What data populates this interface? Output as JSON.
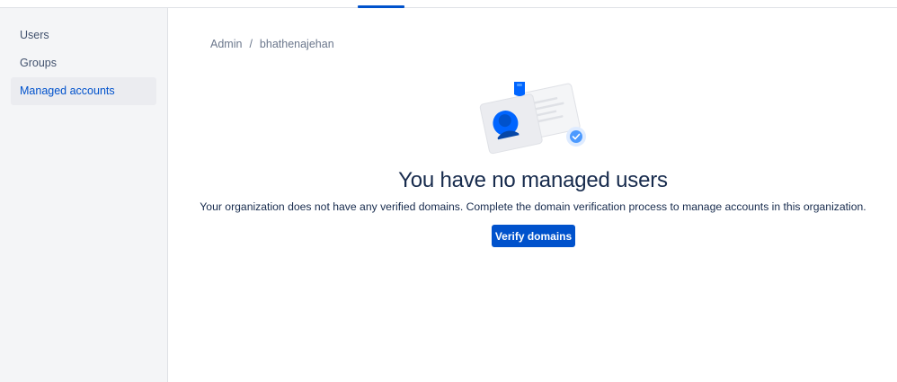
{
  "sidebar": {
    "items": [
      {
        "label": "Users",
        "active": false
      },
      {
        "label": "Groups",
        "active": false
      },
      {
        "label": "Managed accounts",
        "active": true
      }
    ]
  },
  "breadcrumb": {
    "items": [
      "Admin",
      "bhathenajehan"
    ],
    "separator": "/"
  },
  "empty_state": {
    "illustration_icon": "id-card-verified-icon",
    "title": "You have no managed users",
    "description": "Your organization does not have any verified domains. Complete the domain verification process to manage accounts in this organization.",
    "button_label": "Verify domains"
  },
  "colors": {
    "accent": "#0052CC",
    "sidebar_bg": "#F4F5F7",
    "text_primary": "#172B4D",
    "text_secondary": "#6B778C"
  }
}
